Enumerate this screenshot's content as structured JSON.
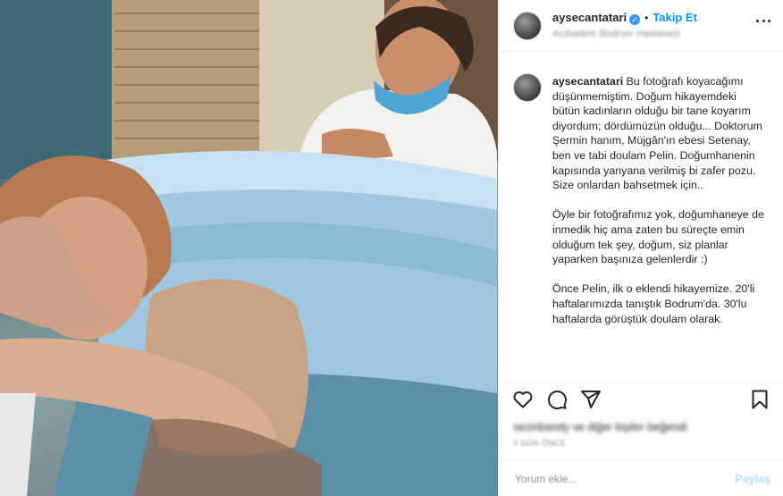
{
  "post": {
    "username": "aysecantatari",
    "follow_label": "Takip Et",
    "separator": "•",
    "location": "Acıbadem Bodrum Hastanesi",
    "caption": "Bu fotoğrafı koyacağımı düşünmemiştim. Doğum hikayemdeki bütün kadınların olduğu bir tane koyarım diyordum; dördümüzün olduğu... Doktorum Şermin hanım, Müjgân'ın ebesi Setenay, ben ve tabi doulam Pelin. Doğumhanenin kapısında yanyana verilmiş bi zafer pozu. Size onlardan bahsetmek için..\n\nÖyle bir fotoğrafımız yok, doğumhaneye de inmedik hiç ama zaten bu süreçte emin olduğum tek şey, doğum, siz planlar yaparken başınıza gelenlerdir :)\n\nÖnce Pelin, ilk o eklendi hikayemize. 20'li haftalarımızda tanıştık Bodrum'da. 30'lu haftalarda görüştük doulam olarak.",
    "likes_text": "sezinbandy ve diğer kişiler beğendi",
    "time_text": "3 GÜN ÖNCE",
    "comment_placeholder": "Yorum ekle...",
    "post_button": "Paylaş"
  },
  "icons": {
    "verified": "verified-badge-icon",
    "more": "more-options-icon",
    "like": "heart-icon",
    "comment": "comment-icon",
    "share": "share-icon",
    "save": "bookmark-icon"
  },
  "colors": {
    "accent": "#0095f6",
    "verified": "#3897f0",
    "muted": "#8e8e8e",
    "border": "#efefef"
  }
}
